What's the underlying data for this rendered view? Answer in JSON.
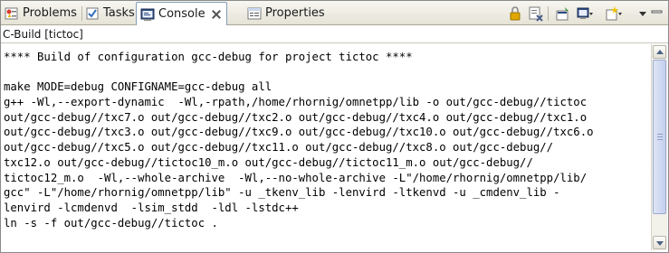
{
  "tabs": [
    {
      "label": "Problems",
      "icon": "problems-icon",
      "active": false
    },
    {
      "label": "Tasks",
      "icon": "tasks-icon",
      "active": false
    },
    {
      "label": "Console",
      "icon": "console-icon",
      "active": true
    },
    {
      "label": "Properties",
      "icon": "properties-icon",
      "active": false
    }
  ],
  "toolbar": {
    "icons": [
      "scroll-lock-icon",
      "clear-console-icon",
      "pin-console-icon",
      "display-console-icon",
      "open-console-icon",
      "view-menu-icon"
    ]
  },
  "console": {
    "name": "C-Build [tictoc]",
    "lines": [
      "**** Build of configuration gcc-debug for project tictoc ****",
      "",
      "make MODE=debug CONFIGNAME=gcc-debug all",
      "g++ -Wl,--export-dynamic  -Wl,-rpath,/home/rhornig/omnetpp/lib -o out/gcc-debug//tictoc",
      "out/gcc-debug//txc7.o out/gcc-debug//txc2.o out/gcc-debug//txc4.o out/gcc-debug//txc1.o",
      "out/gcc-debug//txc3.o out/gcc-debug//txc9.o out/gcc-debug//txc10.o out/gcc-debug//txc6.o",
      "out/gcc-debug//txc5.o out/gcc-debug//txc11.o out/gcc-debug//txc8.o out/gcc-debug//",
      "txc12.o out/gcc-debug//tictoc10_m.o out/gcc-debug//tictoc11_m.o out/gcc-debug//",
      "tictoc12_m.o  -Wl,--whole-archive  -Wl,--no-whole-archive -L\"/home/rhornig/omnetpp/lib/",
      "gcc\" -L\"/home/rhornig/omnetpp/lib\" -u _tkenv_lib -lenvird -ltkenvd -u _cmdenv_lib -",
      "lenvird -lcmdenvd  -lsim_stdd  -ldl -lstdc++",
      "ln -s -f out/gcc-debug//tictoc ."
    ]
  },
  "scrollbar": {
    "position": 0.0,
    "visible_fraction": 0.88
  },
  "colors": {
    "accent": "#7f9db9",
    "tab_bar": "#ece9d8",
    "scroll_thumb": "#c4d0ee"
  }
}
